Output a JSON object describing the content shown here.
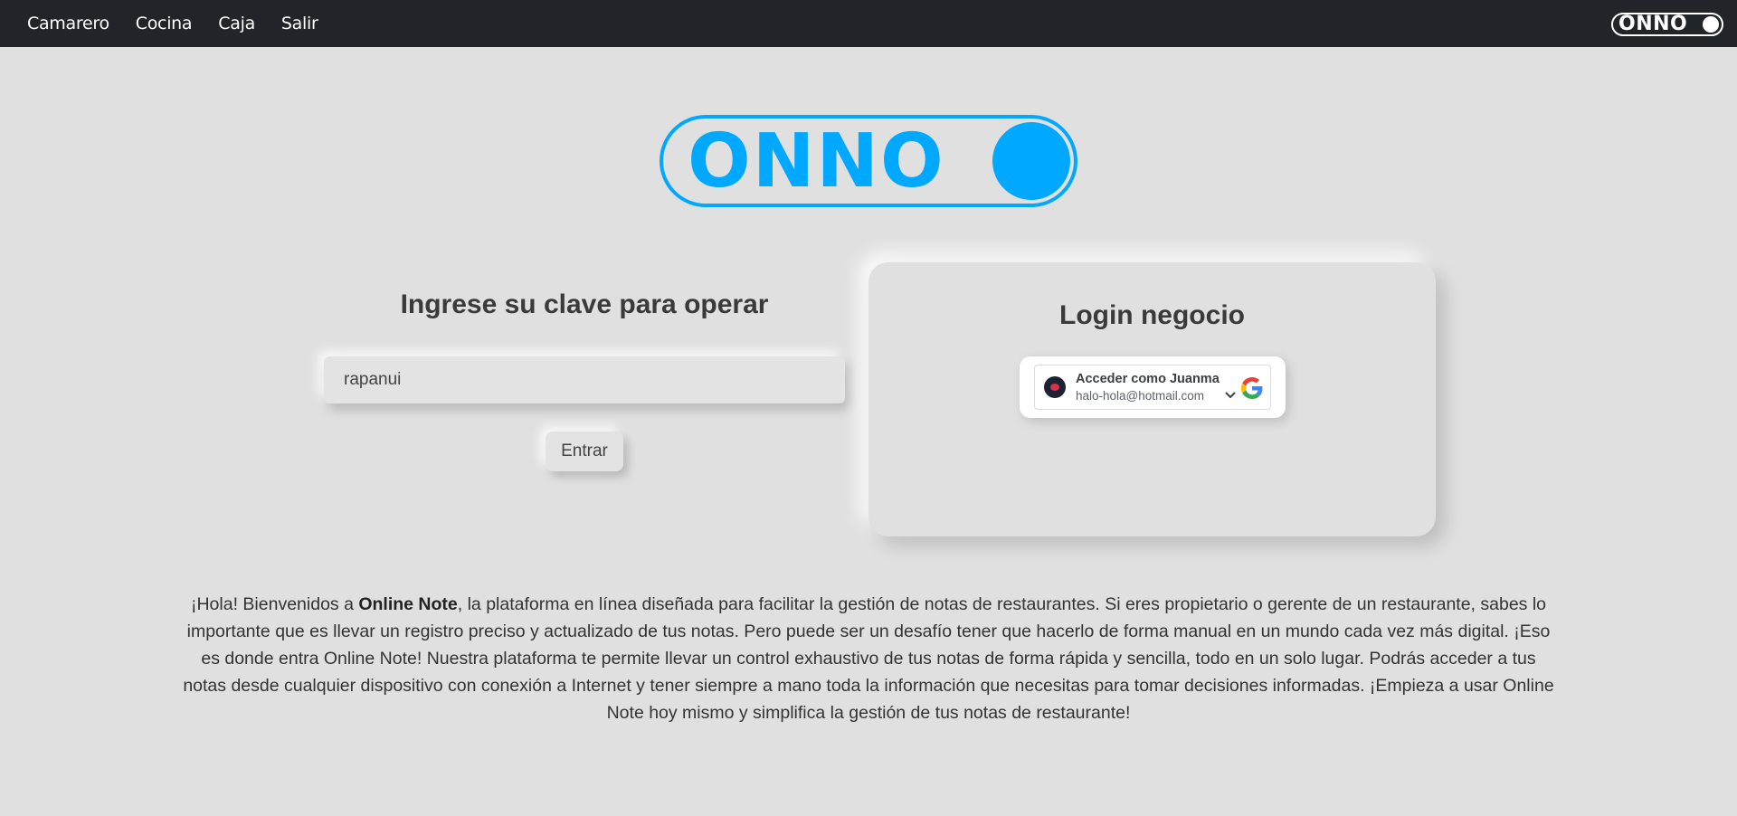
{
  "nav": {
    "items": [
      {
        "label": "Camarero"
      },
      {
        "label": "Cocina"
      },
      {
        "label": "Caja"
      },
      {
        "label": "Salir"
      }
    ],
    "logo_text": "ONNO"
  },
  "hero": {
    "logo_text": "ONNO"
  },
  "operator_panel": {
    "title": "Ingrese su clave para operar",
    "input_value": "rapanui",
    "submit_label": "Entrar"
  },
  "business_login": {
    "title": "Login negocio",
    "google_account_label": "Acceder como Juanma",
    "google_account_email": "halo-hola@hotmail.com"
  },
  "intro": {
    "part1": "¡Hola! Bienvenidos a ",
    "brand": "Online Note",
    "part2": ", la plataforma en línea diseñada para facilitar la gestión de notas de restaurantes. Si eres propietario o gerente de un restaurante, sabes lo importante que es llevar un registro preciso y actualizado de tus notas. Pero puede ser un desafío tener que hacerlo de forma manual en un mundo cada vez más digital. ¡Eso es donde entra Online Note! Nuestra plataforma te permite llevar un control exhaustivo de tus notas de forma rápida y sencilla, todo en un solo lugar. Podrás acceder a tus notas desde cualquier dispositivo con conexión a Internet y tener siempre a mano toda la información que necesitas para tomar decisiones informadas. ¡Empieza a usar Online Note hoy mismo y simplifica la gestión de tus notas de restaurante!"
  },
  "colors": {
    "brand_blue": "#00a8ff",
    "navbar_bg": "#212529",
    "page_bg": "#e0e0e0"
  },
  "icons": [
    "avatar-icon",
    "chevron-down-icon",
    "google-icon"
  ]
}
